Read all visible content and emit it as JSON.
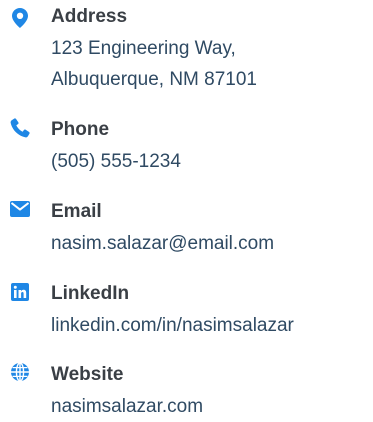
{
  "contacts": [
    {
      "icon": "map-pin-icon",
      "label": "Address",
      "lines": [
        "123 Engineering Way,",
        "Albuquerque, NM 87101"
      ]
    },
    {
      "icon": "phone-icon",
      "label": "Phone",
      "lines": [
        "(505) 555-1234"
      ]
    },
    {
      "icon": "envelope-icon",
      "label": "Email",
      "lines": [
        "nasim.salazar@email.com"
      ]
    },
    {
      "icon": "linkedin-icon",
      "label": "LinkedIn",
      "lines": [
        "linkedin.com/in/nasimsalazar"
      ]
    },
    {
      "icon": "globe-icon",
      "label": "Website",
      "lines": [
        "nasimsalazar.com"
      ]
    }
  ],
  "colors": {
    "icon": "#1f87e5",
    "label": "#3a3f45",
    "value": "#2f4a63"
  }
}
